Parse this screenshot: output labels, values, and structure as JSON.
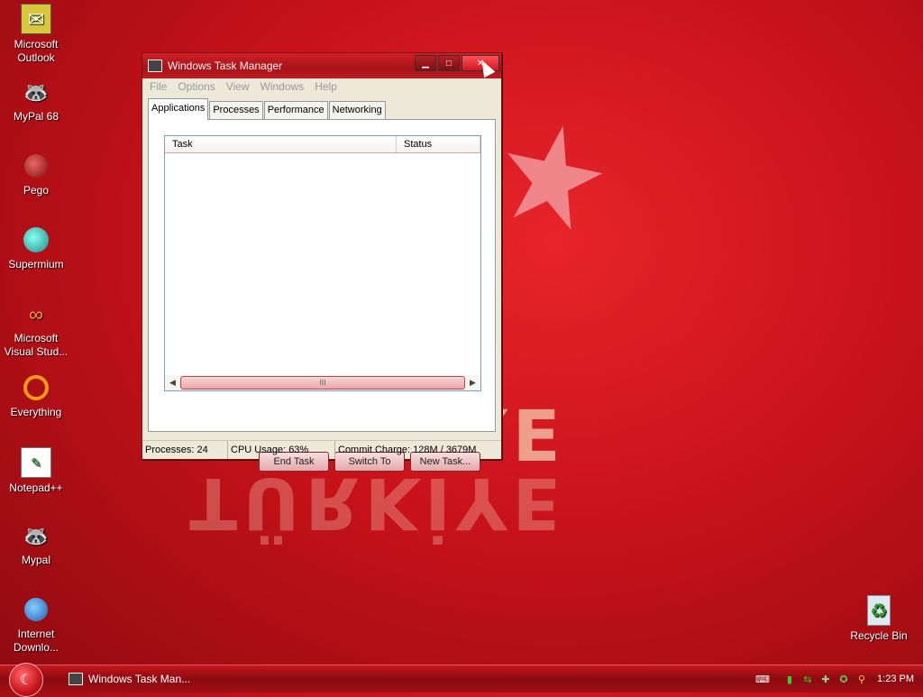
{
  "wallpaper": {
    "text": "TÜRKİYE"
  },
  "desktop_icons": [
    {
      "label": "Microsoft Outlook",
      "icon": "outlook-icon"
    },
    {
      "label": "MyPal 68",
      "icon": "mypal-icon"
    },
    {
      "label": "Pego",
      "icon": "pego-icon"
    },
    {
      "label": "Supermium",
      "icon": "supermium-icon"
    },
    {
      "label": "Microsoft Visual Stud...",
      "icon": "visual-studio-icon"
    },
    {
      "label": "Everything",
      "icon": "everything-icon"
    },
    {
      "label": "Notepad++",
      "icon": "notepad-plus-icon"
    },
    {
      "label": "Mypal",
      "icon": "mypal-icon"
    },
    {
      "label": "Internet Downlo...",
      "icon": "internet-download-icon"
    },
    {
      "label": "Recycle Bin",
      "icon": "recycle-bin-icon"
    }
  ],
  "window": {
    "title": "Windows Task Manager",
    "menu": [
      "File",
      "Options",
      "View",
      "Windows",
      "Help"
    ],
    "tabs": [
      "Applications",
      "Processes",
      "Performance",
      "Networking"
    ],
    "active_tab": "Applications",
    "columns": [
      "Task",
      "Status"
    ],
    "scroll_grip": "III",
    "buttons": {
      "end_task": "End Task",
      "switch_to": "Switch To",
      "new_task": "New Task..."
    },
    "status": {
      "processes": "Processes: 24",
      "cpu": "CPU Usage: 63%",
      "commit": "Commit Charge: 128M / 3679M"
    }
  },
  "taskbar": {
    "task_button": "Windows Task Man...",
    "clock": "1:23 PM"
  },
  "colors": {
    "accent": "#c8121a",
    "taskbar": "#a10f15"
  }
}
